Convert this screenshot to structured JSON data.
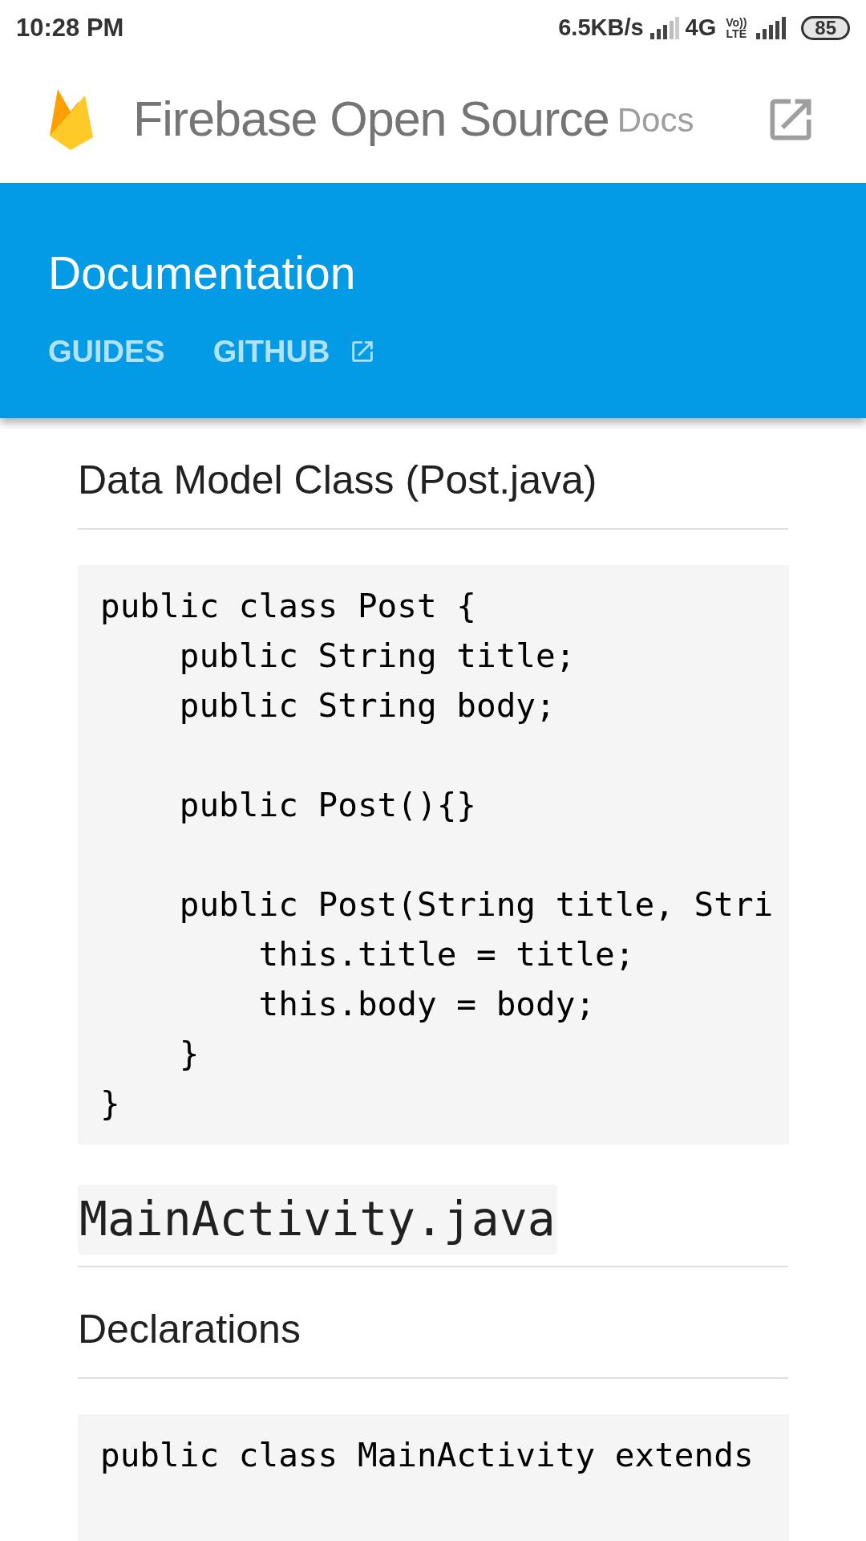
{
  "status_bar": {
    "time": "10:28 PM",
    "speed": "6.5KB/s",
    "network": "4G",
    "volte": "Vo)) LTE",
    "battery": "85"
  },
  "header": {
    "title": "Firebase Open Source",
    "subtitle": "Docs"
  },
  "banner": {
    "title": "Documentation",
    "tabs": [
      {
        "label": "GUIDES",
        "selected": false,
        "external": false
      },
      {
        "label": "GITHUB",
        "selected": false,
        "external": true
      }
    ]
  },
  "content": [
    {
      "kind": "heading",
      "text": "Data Model Class (Post.java)"
    },
    {
      "kind": "code",
      "groups": [
        [
          "public class Post {",
          "    public String title;",
          "    public String body;"
        ],
        [
          "    public Post(){}"
        ],
        [
          "    public Post(String title, Stri",
          "        this.title = title;",
          "        this.body = body;",
          "    }",
          "}"
        ]
      ]
    },
    {
      "kind": "code_heading",
      "text": "MainActivity.java"
    },
    {
      "kind": "heading",
      "text": "Declarations"
    },
    {
      "kind": "code",
      "groups": [
        [
          "public class MainActivity extends"
        ]
      ]
    }
  ]
}
